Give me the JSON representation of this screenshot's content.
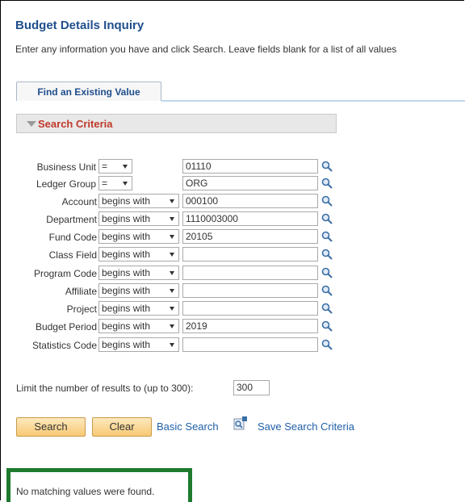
{
  "page": {
    "title": "Budget Details Inquiry",
    "instructions": "Enter any information you have and click Search. Leave fields blank for a list of all values"
  },
  "tab": {
    "label": "Find an Existing Value"
  },
  "section": {
    "label": "Search Criteria"
  },
  "criteria": [
    {
      "label": "Business Unit",
      "op": "=",
      "value": ""
    },
    {
      "label": "Ledger Group",
      "op": "=",
      "value": ""
    },
    {
      "label": "Account",
      "op": "begins with",
      "value": ""
    },
    {
      "label": "Department",
      "op": "begins with",
      "value": ""
    },
    {
      "label": "Fund Code",
      "op": "begins with",
      "value": ""
    },
    {
      "label": "Class Field",
      "op": "begins with",
      "value": ""
    },
    {
      "label": "Program Code",
      "op": "begins with",
      "value": ""
    },
    {
      "label": "Affiliate",
      "op": "begins with",
      "value": ""
    },
    {
      "label": "Project",
      "op": "begins with",
      "value": ""
    },
    {
      "label": "Budget Period",
      "op": "begins with",
      "value": ""
    },
    {
      "label": "Statistics Code",
      "op": "begins with",
      "value": ""
    }
  ],
  "values": {
    "business_unit": "01110",
    "ledger_group": "ORG",
    "account": "000100",
    "department": "1110003000",
    "fund_code": "20105",
    "class_field": "",
    "program_code": "",
    "affiliate": "",
    "project": "",
    "budget_period": "2019",
    "statistics_code": ""
  },
  "limit": {
    "label": "Limit the number of results to (up to 300):",
    "value": "300"
  },
  "buttons": {
    "search": "Search",
    "clear": "Clear",
    "basic_search": "Basic Search",
    "save_search": "Save Search Criteria"
  },
  "message": "No matching values were found.",
  "colors": {
    "title": "#1f4e8c",
    "section_label": "#c0392b",
    "button": "#f7c974",
    "highlight_box": "#1e7b2e"
  }
}
